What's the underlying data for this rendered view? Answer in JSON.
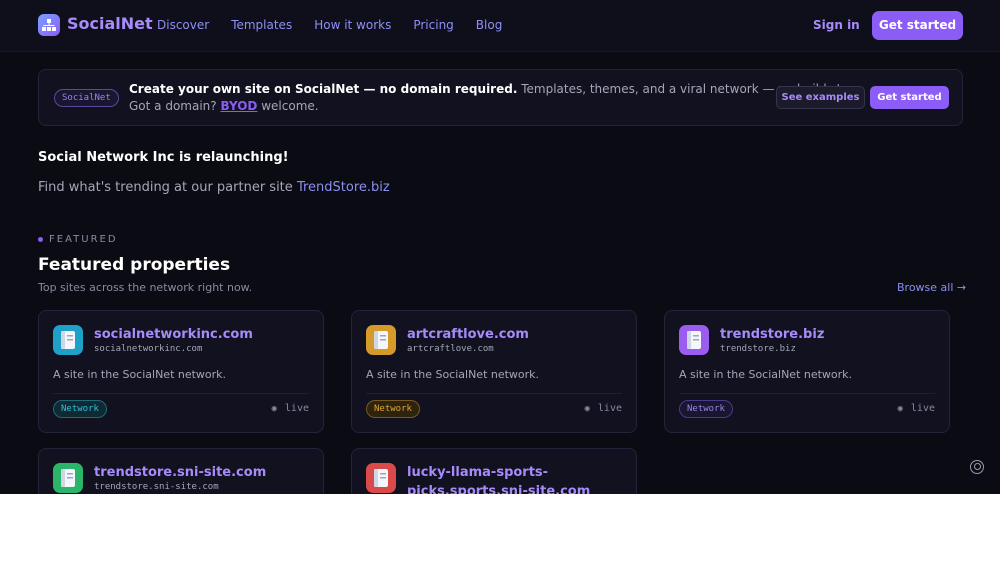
{
  "brand": {
    "name": "SocialNet",
    "accent": "#8b5cf6"
  },
  "nav": {
    "items": [
      "Discover",
      "Templates",
      "How it works",
      "Pricing",
      "Blog"
    ]
  },
  "header": {
    "signin": "Sign in",
    "cta": "Get started"
  },
  "banner": {
    "pill": "SocialNet",
    "headline": "Create your own site on SocialNet — no domain required.",
    "headline_rest": "Templates, themes, and a viral network — no build step.",
    "line2_prefix": "Got a domain?",
    "line2_link": "BYOD",
    "line2_suffix": "welcome.",
    "examples_button": "See examples",
    "cta_button": "Get started"
  },
  "announcement": {
    "title": "Social Network Inc is relaunching!",
    "text": "Find what's trending at our partner site",
    "link": "TrendStore.biz"
  },
  "featured": {
    "eyebrow": "FEATURED",
    "title": "Featured properties",
    "subtitle": "Top sites across the network right now.",
    "browse": "Browse all →",
    "cards": [
      {
        "name": "socialnetworkinc.com",
        "domain": "socialnetworkinc.com",
        "desc": "A site in the SocialNet network.",
        "tag": "Network",
        "status": "live",
        "icon": "book-icon",
        "tint": "#1fa0c8"
      },
      {
        "name": "artcraftlove.com",
        "domain": "artcraftlove.com",
        "desc": "A site in the SocialNet network.",
        "tag": "Network",
        "status": "live",
        "icon": "book-icon",
        "tint": "#d69a2a"
      },
      {
        "name": "trendstore.biz",
        "domain": "trendstore.biz",
        "desc": "A site in the SocialNet network.",
        "tag": "Network",
        "status": "live",
        "icon": "book-icon",
        "tint": "#9b5cf0"
      },
      {
        "name": "trendstore.sni-site.com",
        "domain": "trendstore.sni-site.com",
        "desc": "",
        "tag": "",
        "status": "",
        "icon": "book-icon",
        "tint": "#2bb56a"
      },
      {
        "name": "lucky-llama-sports-picks.sports.sni-site.com",
        "domain": "",
        "desc": "",
        "tag": "",
        "status": "",
        "icon": "book-icon",
        "tint": "#d94a4a"
      }
    ]
  },
  "icons": {
    "fab": "user-circle-icon"
  }
}
